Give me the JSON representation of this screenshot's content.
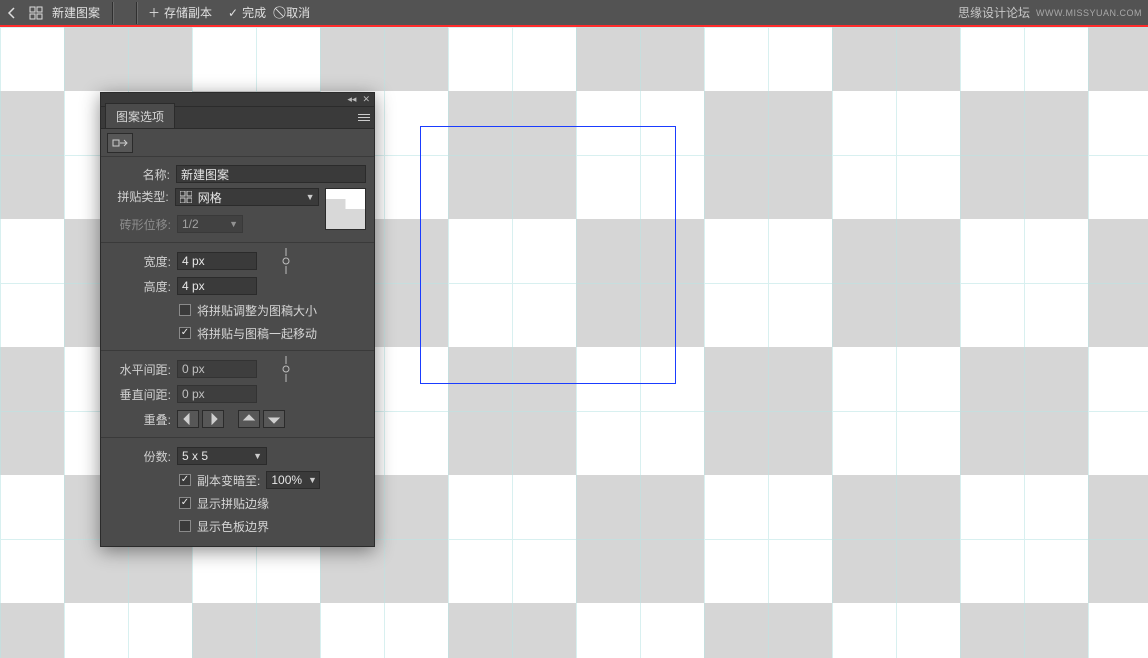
{
  "topbar": {
    "title": "新建图案",
    "actions": {
      "save_copy": "存储副本",
      "done": "完成",
      "cancel": "取消"
    },
    "watermark": {
      "text": "思缘设计论坛",
      "url": "WWW.MISSYUAN.COM"
    }
  },
  "panel": {
    "tab_label": "图案选项",
    "name_label": "名称:",
    "name_value": "新建图案",
    "tile_type_label": "拼贴类型:",
    "tile_type_value": "网格",
    "tile_type_icon": "grid-icon",
    "brick_offset_label": "砖形位移:",
    "brick_offset_value": "1/2",
    "width_label": "宽度:",
    "width_value": "4 px",
    "height_label": "高度:",
    "height_value": "4 px",
    "resize_tile_to_art_label": "将拼贴调整为图稿大小",
    "resize_tile_to_art_checked": false,
    "move_tile_with_art_label": "将拼贴与图稿一起移动",
    "move_tile_with_art_checked": true,
    "h_spacing_label": "水平间距:",
    "h_spacing_value": "0 px",
    "v_spacing_label": "垂直间距:",
    "v_spacing_value": "0 px",
    "overlap_label": "重叠:",
    "copies_label": "份数:",
    "copies_value": "5 x 5",
    "dim_to_label": "副本变暗至:",
    "dim_to_value": "100%",
    "dim_to_checked": true,
    "show_tile_edge_label": "显示拼贴边缘",
    "show_tile_edge_checked": true,
    "show_swatch_bounds_label": "显示色板边界",
    "show_swatch_bounds_checked": false
  }
}
